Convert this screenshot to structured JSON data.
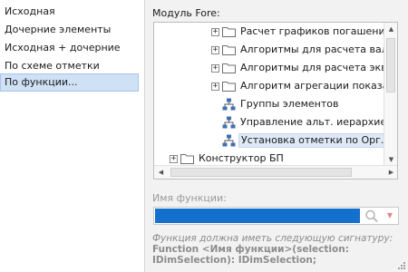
{
  "left_list": {
    "items": [
      {
        "label": "Исходная",
        "selected": false
      },
      {
        "label": "Дочерние элементы",
        "selected": false
      },
      {
        "label": "Исходная + дочерние",
        "selected": false
      },
      {
        "label": "По схеме отметки",
        "selected": false
      },
      {
        "label": "По функции...",
        "selected": true
      }
    ]
  },
  "module": {
    "label": "Модуль Fore:",
    "tree": [
      {
        "text": "Расчет графиков погашения фи",
        "icon": "folder-icon",
        "expander": "+"
      },
      {
        "text": "Алгоритмы для расчета валютн",
        "icon": "folder-icon",
        "expander": "+"
      },
      {
        "text": "Алгоритмы для расчета эквива",
        "icon": "folder-icon",
        "expander": "+"
      },
      {
        "text": "Алгоритм агрегации показателя",
        "icon": "folder-icon",
        "expander": "+"
      },
      {
        "text": "Группы элементов",
        "icon": "hierarchy-icon",
        "expander": ""
      },
      {
        "text": "Управление альт. иерархией",
        "icon": "hierarchy-icon",
        "expander": ""
      },
      {
        "text": "Установка отметки по Орг.стру",
        "icon": "hierarchy-icon",
        "expander": "",
        "selected": true
      },
      {
        "text": "Конструктор БП",
        "icon": "folder-icon",
        "expander": "+"
      }
    ]
  },
  "function": {
    "label": "Имя функции:",
    "value": "",
    "hint": "Функция должна иметь следующую сигнатуру:",
    "signature_line1": "Function <Имя функции>(selection:",
    "signature_line2": "IDimSelection): IDimSelection;"
  },
  "colors": {
    "selection": "#cfe1f5",
    "input_fill": "#1470cc",
    "disabled_text": "#9a9a9a"
  }
}
